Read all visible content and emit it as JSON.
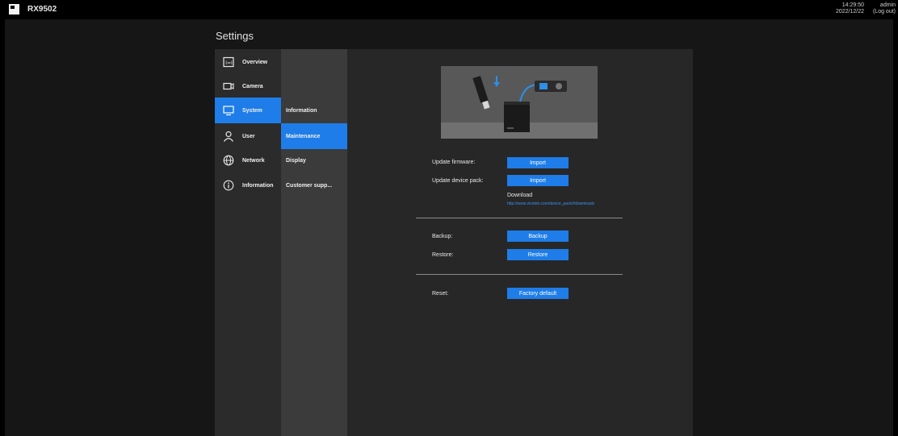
{
  "app": {
    "title": "RX9502",
    "time": "14:29:50",
    "date": "2022/12/22",
    "user": "admin",
    "logout_label": "(Log out)"
  },
  "page_title": "Settings",
  "nav_primary": [
    {
      "label": "Overview",
      "icon": "overview-icon",
      "active": false
    },
    {
      "label": "Camera",
      "icon": "camera-icon",
      "active": false
    },
    {
      "label": "System",
      "icon": "monitor-icon",
      "active": true
    },
    {
      "label": "User",
      "icon": "user-icon",
      "active": false
    },
    {
      "label": "Network",
      "icon": "globe-icon",
      "active": false
    },
    {
      "label": "Information",
      "icon": "info-icon",
      "active": false
    }
  ],
  "nav_secondary": [
    {
      "label": "Information",
      "active": false
    },
    {
      "label": "Maintenance",
      "active": true
    },
    {
      "label": "Display",
      "active": false
    },
    {
      "label": "Customer supp...",
      "active": false
    }
  ],
  "maintenance": {
    "update_firmware_label": "Update firmware:",
    "update_firmware_button": "Import",
    "update_device_pack_label": "Update device pack:",
    "update_device_pack_button": "Import",
    "download_label": "Download",
    "download_link": "http://www.vivotek.com/device_pack/#downloads",
    "backup_label": "Backup:",
    "backup_button": "Backup",
    "restore_label": "Restore:",
    "restore_button": "Restore",
    "reset_label": "Reset:",
    "reset_button": "Factory default"
  },
  "colors": {
    "accent": "#1e7de8",
    "background": "#161616",
    "nav_primary_bg": "#2b2b2b",
    "nav_secondary_bg": "#3b3b3b",
    "content_bg": "#272727"
  }
}
